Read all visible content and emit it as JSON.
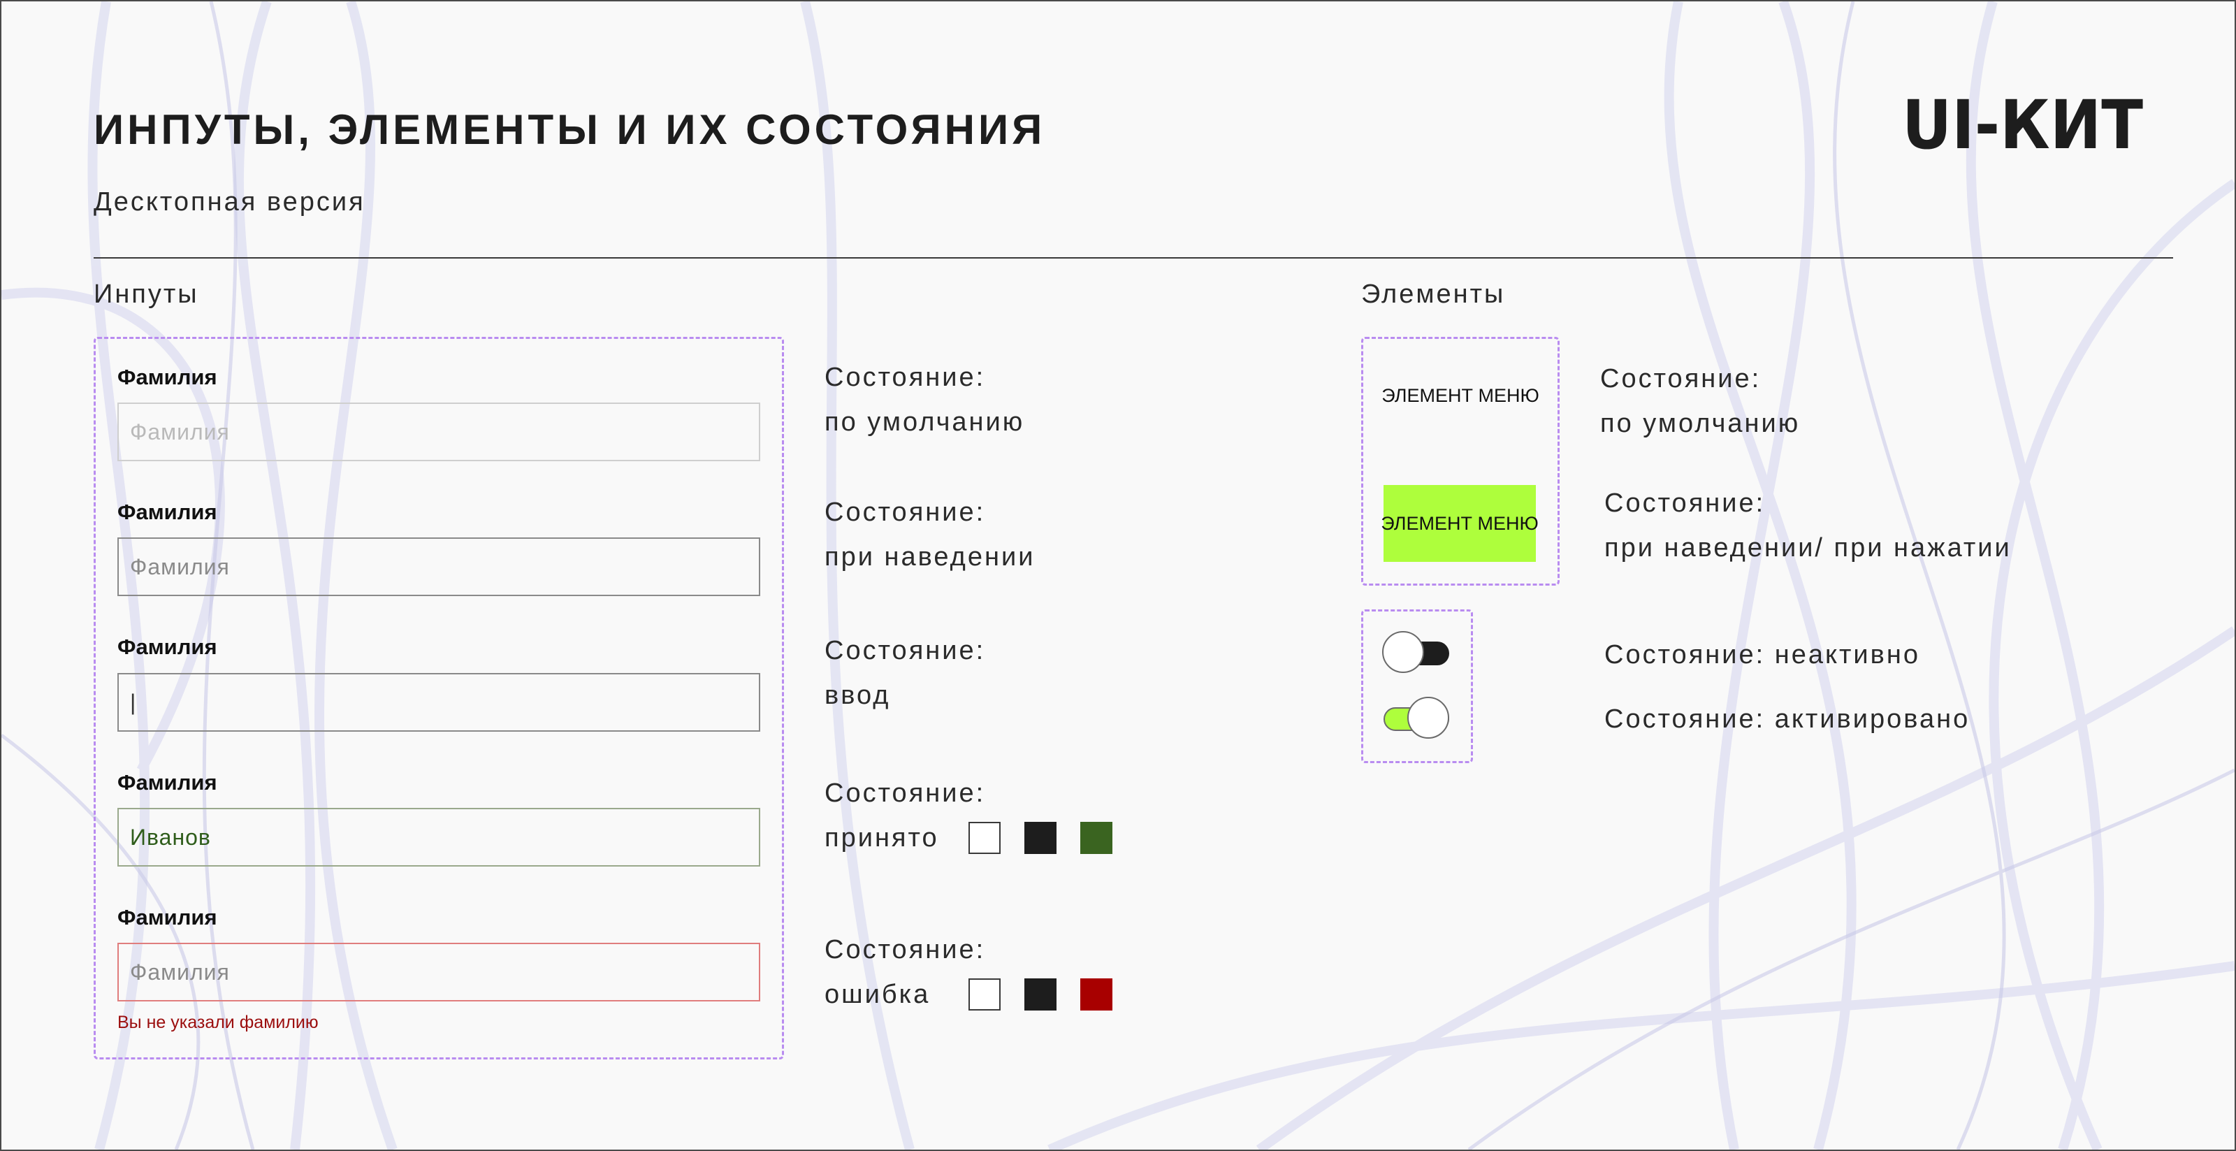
{
  "header": {
    "title": "ИНПУТЫ, ЭЛЕМЕНТЫ И ИХ СОСТОЯНИЯ",
    "subtitle": "Десктопная версия",
    "logo_text": "UI-КИТ"
  },
  "inputs_section": {
    "label": "Инпуты",
    "fields": [
      {
        "label": "Фамилия",
        "placeholder": "Фамилия",
        "value": ""
      },
      {
        "label": "Фамилия",
        "placeholder": "Фамилия",
        "value": ""
      },
      {
        "label": "Фамилия",
        "placeholder": "",
        "value": "|"
      },
      {
        "label": "Фамилия",
        "placeholder": "",
        "value": "Иванов"
      },
      {
        "label": "Фамилия",
        "placeholder": "Фамилия",
        "value": "",
        "error": "Вы не указали фамилию"
      }
    ],
    "states": [
      {
        "title": "Состояние:",
        "name": "по умолчанию"
      },
      {
        "title": "Состояние:",
        "name": "при наведении"
      },
      {
        "title": "Состояние:",
        "name": "ввод"
      },
      {
        "title": "Состояние:",
        "name": "принято",
        "swatches": [
          "#ffffff",
          "#1d1d1d",
          "#3a6420"
        ]
      },
      {
        "title": "Состояние:",
        "name": "ошибка",
        "swatches": [
          "#ffffff",
          "#1d1d1d",
          "#a80000"
        ]
      }
    ]
  },
  "elements_section": {
    "label": "Элементы",
    "menu_items": [
      {
        "label": "ЭЛЕМЕНТ МЕНЮ",
        "state_title": "Состояние:",
        "state_name": "по умолчанию"
      },
      {
        "label": "ЭЛЕМЕНТ МЕНЮ",
        "state_title": "Состояние:",
        "state_name": "при наведении/ при нажатии"
      }
    ],
    "toggles": [
      {
        "on": false,
        "state": "Состояние: неактивно"
      },
      {
        "on": true,
        "state": "Состояние: активировано"
      }
    ]
  },
  "colors": {
    "accent_lime": "#aefe3c",
    "accepted_green": "#3a6420",
    "error_red": "#a80000",
    "dashed_border": "#b98cf0",
    "dark": "#1d1d1d"
  }
}
